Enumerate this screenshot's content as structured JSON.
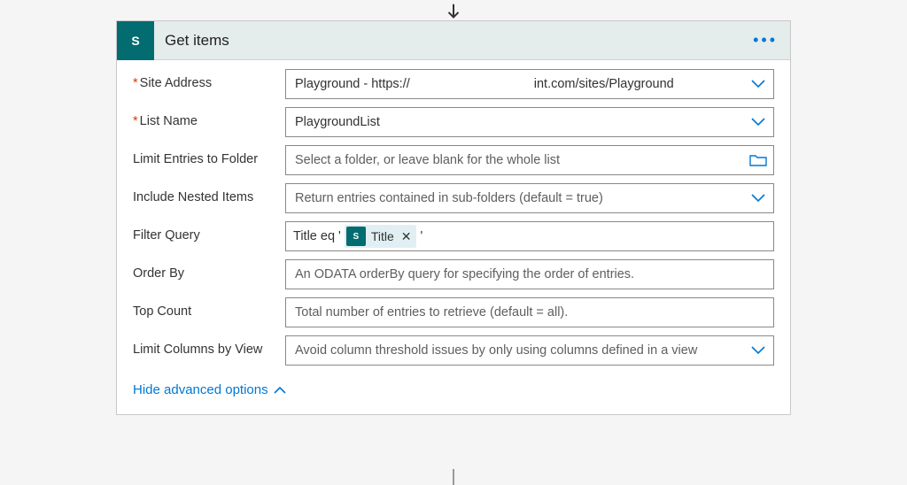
{
  "connector": {
    "title": "Get items",
    "icon_label": "S"
  },
  "fields": {
    "site_address": {
      "label": "Site Address",
      "required": true,
      "value_prefix": "Playground - https://",
      "value_suffix": "int.com/sites/Playground"
    },
    "list_name": {
      "label": "List Name",
      "required": true,
      "value": "PlaygroundList"
    },
    "limit_folder": {
      "label": "Limit Entries to Folder",
      "placeholder": "Select a folder, or leave blank for the whole list"
    },
    "include_nested": {
      "label": "Include Nested Items",
      "placeholder": "Return entries contained in sub-folders (default = true)"
    },
    "filter_query": {
      "label": "Filter Query",
      "prefix": "Title eq '",
      "token_label": "Title",
      "suffix": "'"
    },
    "order_by": {
      "label": "Order By",
      "placeholder": "An ODATA orderBy query for specifying the order of entries."
    },
    "top_count": {
      "label": "Top Count",
      "placeholder": "Total number of entries to retrieve (default = all)."
    },
    "limit_columns": {
      "label": "Limit Columns by View",
      "placeholder": "Avoid column threshold issues by only using columns defined in a view"
    }
  },
  "advanced_toggle": "Hide advanced options"
}
